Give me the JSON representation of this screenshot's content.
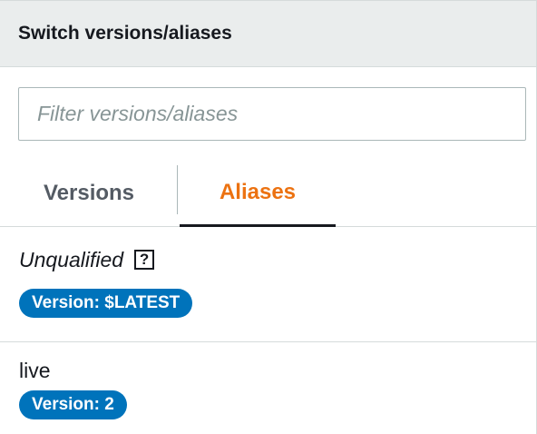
{
  "header": {
    "title": "Switch versions/aliases"
  },
  "filter": {
    "placeholder": "Filter versions/aliases",
    "value": ""
  },
  "tabs": [
    {
      "label": "Versions",
      "active": false
    },
    {
      "label": "Aliases",
      "active": true
    }
  ],
  "aliases": [
    {
      "name": "Unqualified",
      "help_label": "?",
      "version_badge": "Version: $LATEST"
    },
    {
      "name": "live",
      "version_badge": "Version: 2"
    }
  ],
  "colors": {
    "accent_tab": "#ec7211",
    "badge": "#0073bb",
    "header_bg": "#eaeded"
  }
}
